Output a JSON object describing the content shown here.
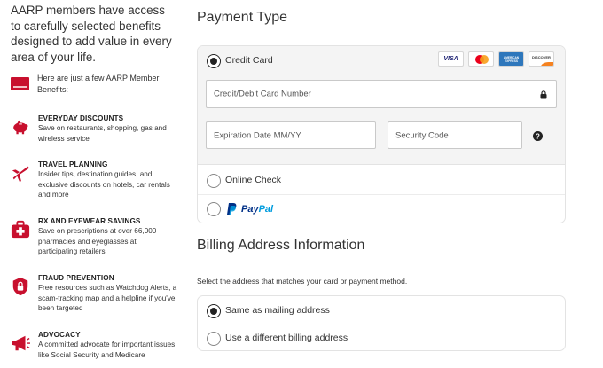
{
  "intro_text": "AARP members have access to carefully selected benefits designed to add value in every area of your life.",
  "card_icon_text": "Member Benefits AARP",
  "here_text": "Here are just a few AARP Member Benefits:",
  "benefits": [
    {
      "title": "EVERYDAY DISCOUNTS",
      "desc": "Save on restaurants, shopping, gas and wireless service",
      "icon": "piggy-bank-icon"
    },
    {
      "title": "TRAVEL PLANNING",
      "desc": "Insider tips, destination guides, and exclusive discounts on hotels, car rentals and more",
      "icon": "airplane-icon"
    },
    {
      "title": "RX AND EYEWEAR SAVINGS",
      "desc": "Save on prescriptions at over 66,000 pharmacies and eyeglasses at participating retailers",
      "icon": "medical-kit-icon"
    },
    {
      "title": "FRAUD PREVENTION",
      "desc": "Free resources such as Watchdog Alerts, a scam-tracking map and a helpline if you've been targeted",
      "icon": "shield-lock-icon"
    },
    {
      "title": "ADVOCACY",
      "desc": "A committed advocate for important issues like Social Security and Medicare",
      "icon": "megaphone-icon"
    }
  ],
  "payment": {
    "heading": "Payment Type",
    "credit_card_label": "Credit Card",
    "card_brands": [
      "VISA",
      "Mastercard",
      "AMERICAN EXPRESS",
      "DISCOVER"
    ],
    "card_number_placeholder": "Credit/Debit Card Number",
    "expiration_placeholder": "Expiration Date MM/YY",
    "security_placeholder": "Security Code",
    "online_check_label": "Online Check",
    "paypal_pay": "Pay",
    "paypal_pal": "Pal",
    "selected": "Credit Card"
  },
  "billing": {
    "heading": "Billing Address Information",
    "help_text": "Select the address that matches your card or payment method.",
    "option_same": "Same as mailing address",
    "option_different": "Use a different billing address",
    "selected": "Same as mailing address"
  },
  "colors": {
    "brand_red": "#c8102e",
    "paypal_dark": "#003087",
    "paypal_light": "#009cde"
  }
}
